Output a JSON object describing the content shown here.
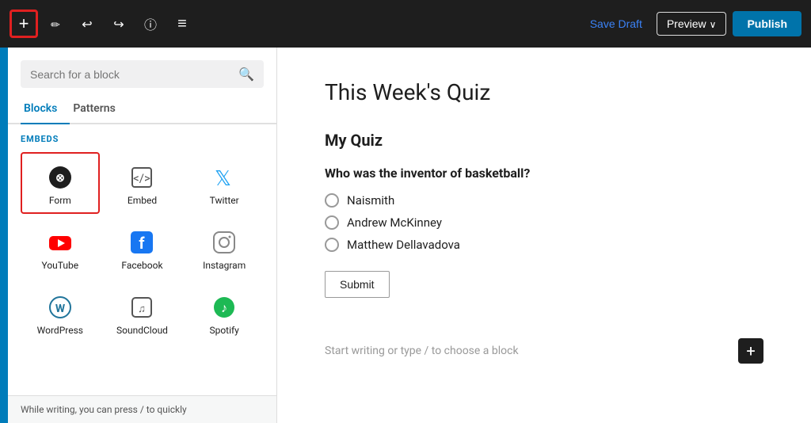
{
  "toolbar": {
    "add_label": "+",
    "save_draft_label": "Save Draft",
    "preview_label": "Preview",
    "publish_label": "Publish"
  },
  "sidebar": {
    "search_placeholder": "Search for a block",
    "tabs": [
      {
        "id": "blocks",
        "label": "Blocks",
        "active": true
      },
      {
        "id": "patterns",
        "label": "Patterns",
        "active": false
      }
    ],
    "section_label": "EMBEDS",
    "blocks": [
      {
        "id": "form",
        "label": "Form",
        "selected": true,
        "icon": "form"
      },
      {
        "id": "embed",
        "label": "Embed",
        "selected": false,
        "icon": "embed"
      },
      {
        "id": "twitter",
        "label": "Twitter",
        "selected": false,
        "icon": "twitter"
      },
      {
        "id": "youtube",
        "label": "YouTube",
        "selected": false,
        "icon": "youtube"
      },
      {
        "id": "facebook",
        "label": "Facebook",
        "selected": false,
        "icon": "facebook"
      },
      {
        "id": "instagram",
        "label": "Instagram",
        "selected": false,
        "icon": "instagram"
      },
      {
        "id": "wordpress",
        "label": "WordPress",
        "selected": false,
        "icon": "wordpress"
      },
      {
        "id": "soundcloud",
        "label": "SoundCloud",
        "selected": false,
        "icon": "soundcloud"
      },
      {
        "id": "spotify",
        "label": "Spotify",
        "selected": false,
        "icon": "spotify"
      }
    ],
    "hint_text": "While writing, you can press / to quickly"
  },
  "editor": {
    "post_title": "This Week's Quiz",
    "quiz_title": "My Quiz",
    "quiz_question": "Who was the inventor of basketball?",
    "options": [
      {
        "id": "opt1",
        "text": "Naismith"
      },
      {
        "id": "opt2",
        "text": "Andrew McKinney"
      },
      {
        "id": "opt3",
        "text": "Matthew Dellavadova"
      }
    ],
    "submit_label": "Submit",
    "add_block_placeholder": "Start writing or type / to choose a block"
  }
}
